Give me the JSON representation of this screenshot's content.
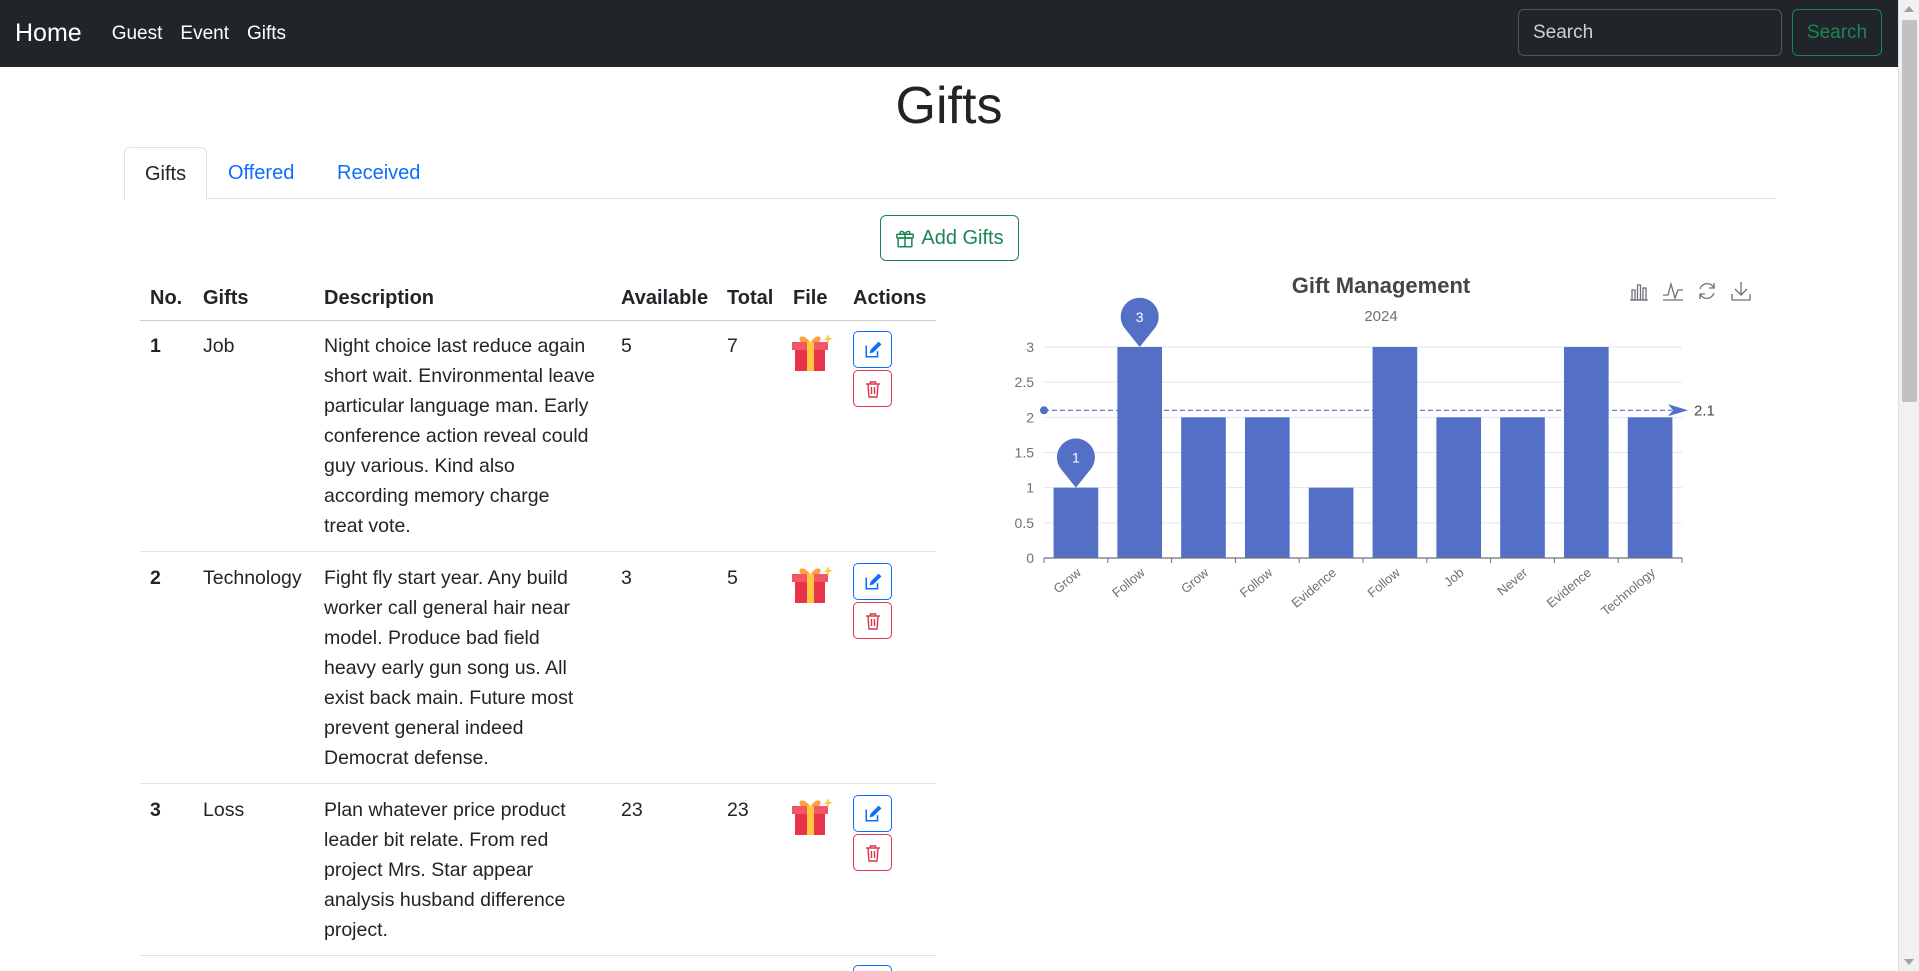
{
  "navbar": {
    "brand": "Home",
    "links": [
      "Guest",
      "Event",
      "Gifts"
    ],
    "search_placeholder": "Search",
    "search_button": "Search"
  },
  "page": {
    "title": "Gifts"
  },
  "tabs": [
    {
      "label": "Gifts",
      "active": true
    },
    {
      "label": "Offered",
      "active": false
    },
    {
      "label": "Received",
      "active": false
    }
  ],
  "add_button": {
    "label": "Add Gifts",
    "icon": "gift-icon"
  },
  "table": {
    "headers": [
      "No.",
      "Gifts",
      "Description",
      "Available",
      "Total",
      "File",
      "Actions"
    ],
    "rows": [
      {
        "no": "1",
        "gift": "Job",
        "description_lines": [
          "Night choice last reduce again",
          "short wait. Environmental leave",
          "particular language man. Early",
          "conference action reveal could",
          "guy various. Kind also",
          "according memory charge",
          "treat vote."
        ],
        "available": "5",
        "total": "7"
      },
      {
        "no": "2",
        "gift": "Technology",
        "description_lines": [
          "Fight fly start year. Any build",
          "worker call general hair near",
          "model. Produce bad field",
          "heavy early gun song us. All",
          "exist back main. Future most",
          "prevent general indeed",
          "Democrat defense."
        ],
        "available": "3",
        "total": "5"
      },
      {
        "no": "3",
        "gift": "Loss",
        "description_lines": [
          "Plan whatever price product",
          "leader bit relate. From red",
          "project Mrs. Star appear",
          "analysis husband difference",
          "project."
        ],
        "available": "23",
        "total": "23"
      }
    ]
  },
  "chart_data": {
    "type": "bar",
    "title": "Gift Management",
    "subtitle": "2024",
    "categories": [
      "Grow",
      "Follow",
      "Grow",
      "Follow",
      "Evidence",
      "Follow",
      "Job",
      "Never",
      "Evidence",
      "Technology"
    ],
    "values": [
      1,
      3,
      2,
      2,
      1,
      3,
      2,
      2,
      3,
      2
    ],
    "ylim": [
      0,
      3
    ],
    "yticks": [
      "0",
      "0.5",
      "1",
      "1.5",
      "2",
      "2.5",
      "3"
    ],
    "mark_points": [
      {
        "label": "3",
        "category_index": 1,
        "value": 3
      },
      {
        "label": "1",
        "category_index": 0,
        "value": 1
      }
    ],
    "mark_line": {
      "label": "2.1",
      "value": 2.1
    },
    "grid": true,
    "bar_color": "#5470c6",
    "toolbox_icons": [
      "bar-chart-icon",
      "line-chart-icon",
      "restore-icon",
      "download-icon"
    ]
  },
  "colors": {
    "navbar_bg": "#212529",
    "success": "#198754",
    "primary": "#0d6efd",
    "danger": "#dc3545"
  }
}
